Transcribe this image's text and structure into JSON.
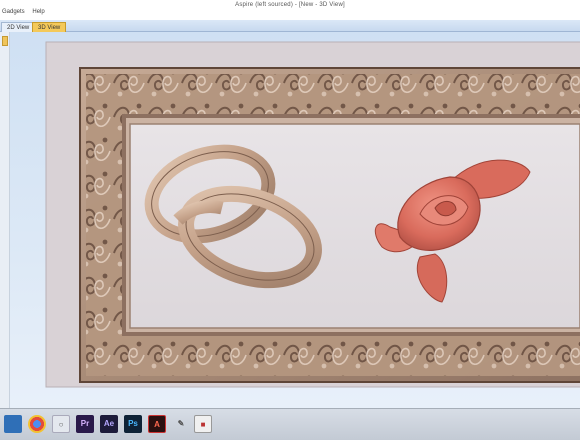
{
  "window": {
    "title": "Aspire (left sourced) - [New - 3D View]"
  },
  "menu": {
    "items": [
      "Gadgets",
      "Help"
    ]
  },
  "tabs": [
    {
      "label": "2D View",
      "active": false
    },
    {
      "label": "3D View",
      "active": true
    }
  ],
  "taskbar": {
    "apps": [
      {
        "name": "windows-start-icon",
        "label": ""
      },
      {
        "name": "chrome-icon",
        "label": ""
      },
      {
        "name": "search-icon",
        "label": ""
      },
      {
        "name": "premiere-icon",
        "label": "Pr"
      },
      {
        "name": "after-effects-icon",
        "label": "Ae"
      },
      {
        "name": "photoshop-icon",
        "label": "Ps"
      },
      {
        "name": "acrobat-icon",
        "label": "A"
      },
      {
        "name": "pen-icon",
        "label": ""
      },
      {
        "name": "aspire-icon",
        "label": ""
      }
    ]
  },
  "colors": {
    "wood": "#b89a86",
    "wood_dark": "#7d6152",
    "rings": "#c9a78c",
    "rose": "#d96b5c",
    "panel": "#e4e0e2"
  }
}
